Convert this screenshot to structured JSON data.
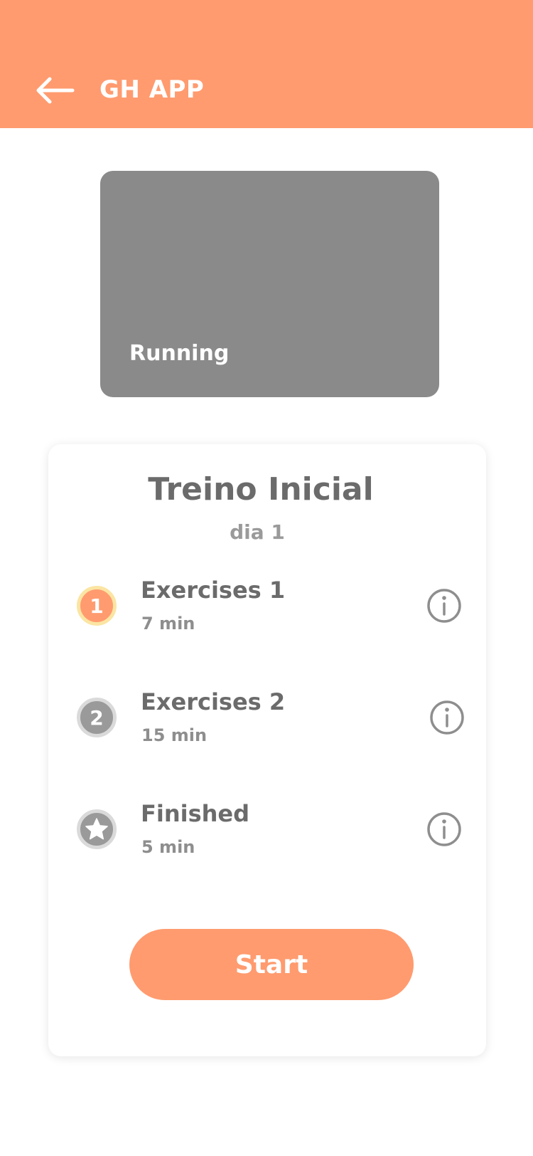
{
  "header": {
    "back_icon": "arrow-left-icon",
    "title": "GH APP",
    "color": "#FF9B6F"
  },
  "hero": {
    "label": "Running",
    "placeholder_color": "#8A8A8A"
  },
  "workout": {
    "title": "Treino Inicial",
    "subtitle": "dia 1",
    "steps": [
      {
        "badge": "1",
        "badge_state": "active",
        "name": "Exercises 1",
        "duration": "7 min",
        "info_icon": "info-icon"
      },
      {
        "badge": "2",
        "badge_state": "pending",
        "name": "Exercises 2",
        "duration": "15 min",
        "info_icon": "info-icon"
      },
      {
        "badge_icon": "star-icon",
        "badge_state": "pending",
        "name": "Finished",
        "duration": "5 min",
        "info_icon": "info-icon"
      }
    ],
    "start_label": "Start"
  },
  "colors": {
    "accent": "#FF9B6F",
    "active_ring": "#FBE5A3",
    "pending_badge": "#9A9A9A",
    "text_primary": "#6B6B6B",
    "text_secondary": "#8E8E8E"
  }
}
